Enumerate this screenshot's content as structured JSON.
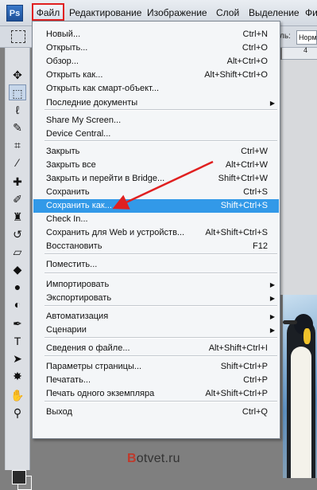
{
  "app": {
    "logo": "Ps"
  },
  "menubar": {
    "items": [
      "Файл",
      "Редактирование",
      "Изображение",
      "Слой",
      "Выделение",
      "Фи"
    ]
  },
  "options": {
    "mode_label": "ль:",
    "style_value": "Норма"
  },
  "ruler": {
    "marks": [
      "4"
    ]
  },
  "file_menu": {
    "items": [
      {
        "label": "Новый...",
        "shortcut": "Ctrl+N"
      },
      {
        "label": "Открыть...",
        "shortcut": "Ctrl+O"
      },
      {
        "label": "Обзор...",
        "shortcut": "Alt+Ctrl+O"
      },
      {
        "label": "Открыть как...",
        "shortcut": "Alt+Shift+Ctrl+O"
      },
      {
        "label": "Открыть как смарт-объект...",
        "shortcut": ""
      },
      {
        "label": "Последние документы",
        "shortcut": "",
        "submenu": true
      },
      {
        "label": "Share My Screen...",
        "shortcut": ""
      },
      {
        "label": "Device Central...",
        "shortcut": ""
      },
      {
        "label": "Закрыть",
        "shortcut": "Ctrl+W"
      },
      {
        "label": "Закрыть все",
        "shortcut": "Alt+Ctrl+W"
      },
      {
        "label": "Закрыть и перейти в Bridge...",
        "shortcut": "Shift+Ctrl+W"
      },
      {
        "label": "Сохранить",
        "shortcut": "Ctrl+S"
      },
      {
        "label": "Сохранить как...",
        "shortcut": "Shift+Ctrl+S",
        "highlighted": true
      },
      {
        "label": "Check In...",
        "shortcut": ""
      },
      {
        "label": "Сохранить для Web и устройств...",
        "shortcut": "Alt+Shift+Ctrl+S"
      },
      {
        "label": "Восстановить",
        "shortcut": "F12"
      },
      {
        "label": "Поместить...",
        "shortcut": ""
      },
      {
        "label": "Импортировать",
        "shortcut": "",
        "submenu": true
      },
      {
        "label": "Экспортировать",
        "shortcut": "",
        "submenu": true
      },
      {
        "label": "Автоматизация",
        "shortcut": "",
        "submenu": true
      },
      {
        "label": "Сценарии",
        "shortcut": "",
        "submenu": true
      },
      {
        "label": "Сведения о файле...",
        "shortcut": "Alt+Shift+Ctrl+I"
      },
      {
        "label": "Параметры страницы...",
        "shortcut": "Shift+Ctrl+P"
      },
      {
        "label": "Печатать...",
        "shortcut": "Ctrl+P"
      },
      {
        "label": "Печать одного экземпляра",
        "shortcut": "Alt+Shift+Ctrl+P"
      },
      {
        "label": "Выход",
        "shortcut": "Ctrl+Q"
      }
    ],
    "submenu_glyph": "▶"
  },
  "toolbox": {
    "tools": [
      {
        "name": "move-tool-icon",
        "glyph": "✥"
      },
      {
        "name": "marquee-tool-icon",
        "glyph": "⬚"
      },
      {
        "name": "lasso-tool-icon",
        "glyph": "ℓ"
      },
      {
        "name": "quick-selection-tool-icon",
        "glyph": "✎"
      },
      {
        "name": "crop-tool-icon",
        "glyph": "⌗"
      },
      {
        "name": "eyedropper-tool-icon",
        "glyph": "⁄"
      },
      {
        "name": "healing-brush-tool-icon",
        "glyph": "✚"
      },
      {
        "name": "brush-tool-icon",
        "glyph": "✐"
      },
      {
        "name": "clone-stamp-tool-icon",
        "glyph": "♜"
      },
      {
        "name": "history-brush-tool-icon",
        "glyph": "↺"
      },
      {
        "name": "eraser-tool-icon",
        "glyph": "▱"
      },
      {
        "name": "gradient-tool-icon",
        "glyph": "◆"
      },
      {
        "name": "blur-tool-icon",
        "glyph": "●"
      },
      {
        "name": "dodge-tool-icon",
        "glyph": "◐"
      },
      {
        "name": "pen-tool-icon",
        "glyph": "✒"
      },
      {
        "name": "type-tool-icon",
        "glyph": "T"
      },
      {
        "name": "path-selection-tool-icon",
        "glyph": "➤"
      },
      {
        "name": "shape-tool-icon",
        "glyph": "✸"
      },
      {
        "name": "hand-tool-icon",
        "glyph": "✋"
      },
      {
        "name": "zoom-tool-icon",
        "glyph": "⚲"
      }
    ]
  },
  "watermark": {
    "brand_initial": "B",
    "brand_rest": "otvet.ru"
  },
  "colors": {
    "highlight": "#3299e8",
    "file_menu_border": "#e02020",
    "arrow": "#e02020"
  }
}
